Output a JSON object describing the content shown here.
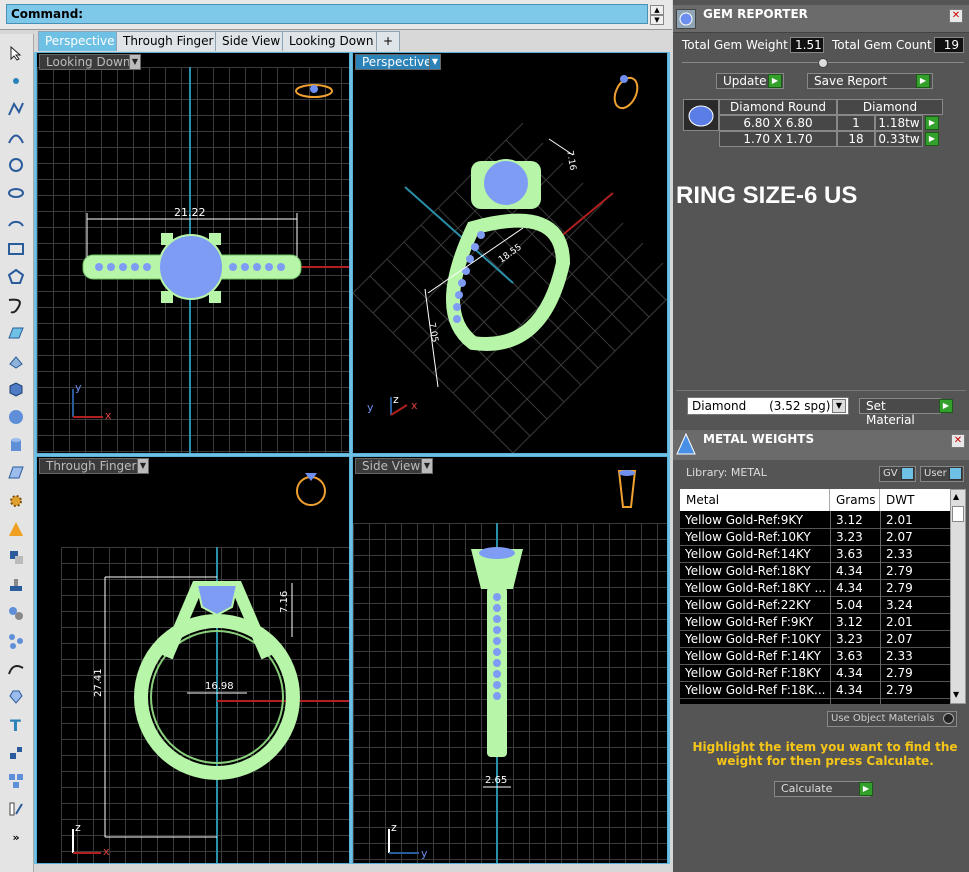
{
  "command": {
    "label": "Command:"
  },
  "tabs": [
    {
      "label": "Perspective",
      "active": true
    },
    {
      "label": "Through Finger",
      "active": false
    },
    {
      "label": "Side View",
      "active": false
    },
    {
      "label": "Looking Down",
      "active": false
    },
    {
      "label": "+",
      "active": false
    }
  ],
  "viewports": {
    "top_left": {
      "label": "Looking Down",
      "dim_width": "21.22",
      "axis_x": "x",
      "axis_y": "y"
    },
    "top_right": {
      "label": "Perspective",
      "dim_a": "18.55",
      "dim_b": "7.16",
      "dim_c": "7.05",
      "axis_x": "x",
      "axis_y": "y",
      "axis_z": "z"
    },
    "bottom_left": {
      "label": "Through Finger",
      "dim_height": "27.41",
      "dim_inner": "16.98",
      "dim_head": "7.16",
      "axis_x": "x",
      "axis_z": "z"
    },
    "bottom_right": {
      "label": "Side View",
      "dim_shank": "2.65",
      "axis_y": "y",
      "axis_z": "z"
    }
  },
  "gem_reporter": {
    "title": "GEM REPORTER",
    "total_weight_label": "Total Gem Weight",
    "total_weight_value": "1.51",
    "total_count_label": "Total Gem Count",
    "total_count_value": "19",
    "update_label": "Update",
    "save_label": "Save Report",
    "table_headers": [
      "Diamond Round",
      "Diamond"
    ],
    "rows": [
      {
        "size": "6.80 X 6.80",
        "count": "1",
        "weight": "1.18tw"
      },
      {
        "size": "1.70 X 1.70",
        "count": "18",
        "weight": "0.33tw"
      }
    ],
    "ring_size": "RING SIZE-6 US",
    "material_select": "Diamond      (3.52 spg)",
    "set_material_label": "Set Material"
  },
  "metal_weights": {
    "title": "METAL WEIGHTS",
    "library_label": "Library: METAL",
    "gv_label": "GV",
    "user_label": "User",
    "headers": [
      "Metal",
      "Grams",
      "DWT"
    ],
    "rows": [
      {
        "metal": "Yellow Gold-Ref:9KY",
        "grams": "3.12",
        "dwt": "2.01"
      },
      {
        "metal": "Yellow Gold-Ref:10KY",
        "grams": "3.23",
        "dwt": "2.07"
      },
      {
        "metal": "Yellow Gold-Ref:14KY",
        "grams": "3.63",
        "dwt": "2.33"
      },
      {
        "metal": "Yellow Gold-Ref:18KY",
        "grams": "4.34",
        "dwt": "2.79"
      },
      {
        "metal": "Yellow Gold-Ref:18KY ...",
        "grams": "4.34",
        "dwt": "2.79"
      },
      {
        "metal": "Yellow Gold-Ref:22KY",
        "grams": "5.04",
        "dwt": "3.24"
      },
      {
        "metal": "Yellow Gold-Ref F:9KY",
        "grams": "3.12",
        "dwt": "2.01"
      },
      {
        "metal": "Yellow Gold-Ref F:10KY",
        "grams": "3.23",
        "dwt": "2.07"
      },
      {
        "metal": "Yellow Gold-Ref F:14KY",
        "grams": "3.63",
        "dwt": "2.33"
      },
      {
        "metal": "Yellow Gold-Ref F:18KY",
        "grams": "4.34",
        "dwt": "2.79"
      },
      {
        "metal": "Yellow Gold-Ref F:18K...",
        "grams": "4.34",
        "dwt": "2.79"
      }
    ],
    "use_object_label": "Use Object Materials",
    "instruction": "Highlight the item you want to find the weight for then press Calculate.",
    "calculate_label": "Calculate"
  },
  "colors": {
    "accent": "#6ec1e4",
    "ring": "#b7f5a8",
    "gem": "#7f9cf5",
    "highlight_text": "#f5c518",
    "button_green": "#33a02c"
  }
}
